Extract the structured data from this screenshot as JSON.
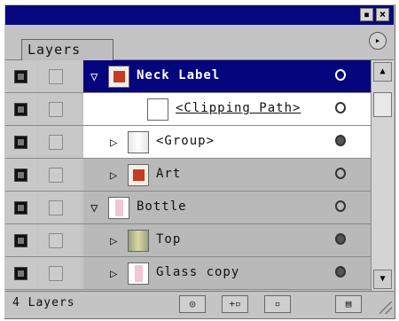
{
  "window": {
    "minimize_glyph": "▪",
    "close_glyph": "×"
  },
  "tabs": [
    {
      "label": "Layers"
    }
  ],
  "menu_glyph": "▸",
  "rows": [
    {
      "name": "Neck Label",
      "expanded": true,
      "selected": true,
      "indent": 0,
      "thumb": "red",
      "target": "ring"
    },
    {
      "name": "<Clipping Path>",
      "expanded": null,
      "selected": false,
      "indent": 2,
      "thumb": "blank",
      "target": "ring",
      "underline": true
    },
    {
      "name": "<Group>",
      "expanded": false,
      "selected": false,
      "indent": 1,
      "thumb": "pale",
      "target": "filled"
    },
    {
      "name": "Art",
      "expanded": false,
      "selected": false,
      "indent": 1,
      "thumb": "red",
      "target": "ring"
    },
    {
      "name": "Bottle",
      "expanded": true,
      "selected": false,
      "indent": 0,
      "thumb": "pink",
      "target": "ring"
    },
    {
      "name": "Top",
      "expanded": false,
      "selected": false,
      "indent": 1,
      "thumb": "green",
      "target": "filled"
    },
    {
      "name": "Glass copy",
      "expanded": false,
      "selected": false,
      "indent": 1,
      "thumb": "pink",
      "target": "filled"
    }
  ],
  "status": {
    "layer_count": "4 Layers"
  },
  "bottom_buttons": [
    {
      "icon": "make-clipping-mask-icon",
      "glyph": "◎"
    },
    {
      "icon": "create-sublayer-icon",
      "glyph": "+▫"
    },
    {
      "icon": "new-layer-icon",
      "glyph": "▫"
    },
    {
      "icon": "trash-icon",
      "glyph": "▤"
    }
  ],
  "colors": {
    "selection": "#05057e",
    "titlebar": "#08087e",
    "panel": "#c4c4c4"
  }
}
